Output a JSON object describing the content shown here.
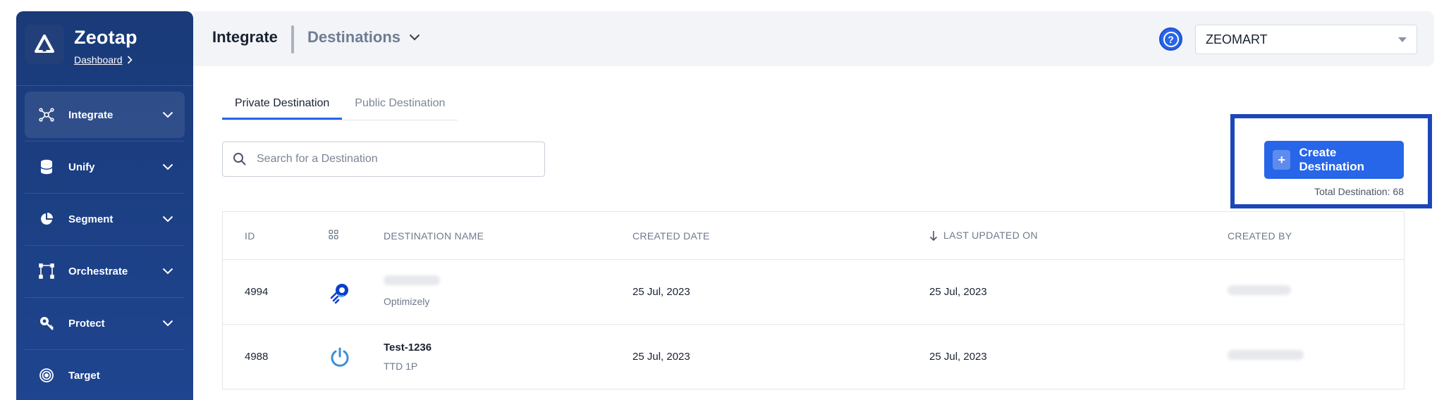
{
  "sidebar": {
    "brand_name": "Zeotap",
    "brand_link": "Dashboard",
    "items": [
      {
        "label": "Integrate",
        "icon": "integrate-icon",
        "active": true
      },
      {
        "label": "Unify",
        "icon": "database-icon"
      },
      {
        "label": "Segment",
        "icon": "pie-chart-icon"
      },
      {
        "label": "Orchestrate",
        "icon": "orchestrate-icon"
      },
      {
        "label": "Protect",
        "icon": "protect-icon"
      },
      {
        "label": "Target",
        "icon": "target-icon"
      }
    ]
  },
  "header": {
    "title": "Integrate",
    "subtitle": "Destinations",
    "org_value": "ZEOMART"
  },
  "tabs": [
    {
      "label": "Private Destination",
      "active": true
    },
    {
      "label": "Public Destination",
      "active": false
    }
  ],
  "search": {
    "placeholder": "Search for a Destination"
  },
  "create": {
    "label": "Create Destination",
    "plus": "+",
    "total": "Total Destination: 68"
  },
  "table": {
    "headers": {
      "id": "ID",
      "name": "DESTINATION NAME",
      "created": "CREATED DATE",
      "updated": "LAST UPDATED ON",
      "by": "CREATED BY"
    },
    "rows": [
      {
        "id": "4994",
        "name": "",
        "type": "Optimizely",
        "created": "25 Jul, 2023",
        "updated": "25 Jul, 2023",
        "icon": "optimizely-icon"
      },
      {
        "id": "4988",
        "name": "Test-1236",
        "type": "TTD 1P",
        "created": "25 Jul, 2023",
        "updated": "25 Jul, 2023",
        "icon": "power-icon"
      }
    ]
  },
  "colors": {
    "accent": "#2766e8",
    "sidebar": "#1a3a78",
    "highlight": "#1c47b8"
  }
}
